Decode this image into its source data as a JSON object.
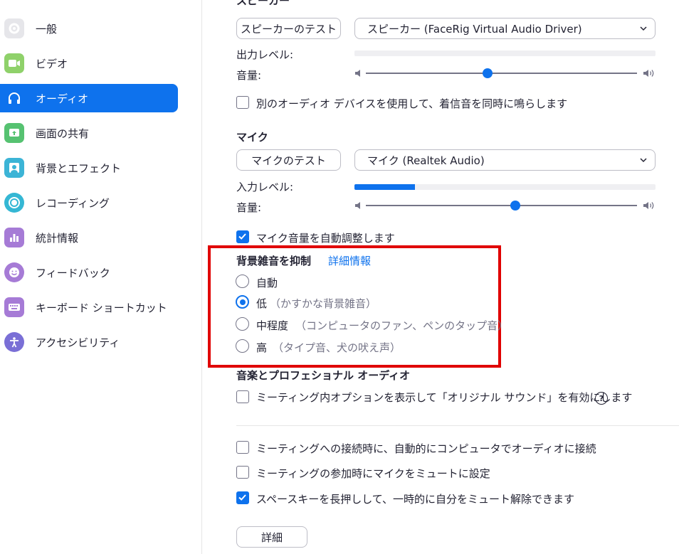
{
  "sidebar": {
    "items": [
      {
        "label": "一般",
        "icon": "gear-icon",
        "color": "#e6e6ea"
      },
      {
        "label": "ビデオ",
        "icon": "video-camera-icon",
        "color": "#8fd16a"
      },
      {
        "label": "オーディオ",
        "icon": "headphones-icon",
        "color": "#0e72ed",
        "active": true
      },
      {
        "label": "画面の共有",
        "icon": "share-screen-icon",
        "color": "#56c271"
      },
      {
        "label": "背景とエフェクト",
        "icon": "background-person-icon",
        "color": "#3cb4d6"
      },
      {
        "label": "レコーディング",
        "icon": "record-icon",
        "color": "#35b7d4"
      },
      {
        "label": "統計情報",
        "icon": "bar-chart-icon",
        "color": "#a67bd6"
      },
      {
        "label": "フィードバック",
        "icon": "smiley-icon",
        "color": "#a67bd6"
      },
      {
        "label": "キーボード ショートカット",
        "icon": "keyboard-icon",
        "color": "#a67bd6"
      },
      {
        "label": "アクセシビリティ",
        "icon": "accessibility-icon",
        "color": "#7a6fd6"
      }
    ]
  },
  "speaker": {
    "heading": "スピーカー",
    "test_button": "スピーカーのテスト",
    "device": "スピーカー (FaceRig Virtual Audio Driver)",
    "output_level_label": "出力レベル:",
    "output_level": 0,
    "volume_label": "音量:",
    "volume": 0.45
  },
  "ringtone_option": {
    "label": "別のオーディオ デバイスを使用して、着信音を同時に鳴らします",
    "checked": false
  },
  "mic": {
    "heading": "マイク",
    "test_button": "マイクのテスト",
    "device": "マイク (Realtek Audio)",
    "input_level_label": "入力レベル:",
    "input_level": 0.2,
    "volume_label": "音量:",
    "volume": 0.55,
    "auto_adjust": {
      "label": "マイク音量を自動調整します",
      "checked": true
    }
  },
  "noise_suppression": {
    "heading": "背景雑音を抑制",
    "more_info": "詳細情報",
    "options": [
      {
        "label": "自動",
        "hint": "",
        "selected": false
      },
      {
        "label": "低",
        "hint": "（かすかな背景雑音）",
        "selected": true
      },
      {
        "label": "中程度",
        "hint": "（コンピュータのファン、ペンのタップ音）",
        "selected": false
      },
      {
        "label": "高",
        "hint": "（タイプ音、犬の吠え声）",
        "selected": false
      }
    ]
  },
  "music_audio": {
    "heading": "音楽とプロフェショナル オーディオ",
    "original_sound": {
      "label": "ミーティング内オプションを表示して「オリジナル サウンド」を有効にします",
      "checked": false
    },
    "help_glyph": "?"
  },
  "options": [
    {
      "label": "ミーティングへの接続時に、自動的にコンピュータでオーディオに接続",
      "checked": false
    },
    {
      "label": "ミーティングの参加時にマイクをミュートに設定",
      "checked": false
    },
    {
      "label": "スペースキーを長押しして、一時的に自分をミュート解除できます",
      "checked": true
    }
  ],
  "advanced_button": "詳細",
  "colors": {
    "accent": "#0e72ed",
    "highlight": "#e00000"
  }
}
